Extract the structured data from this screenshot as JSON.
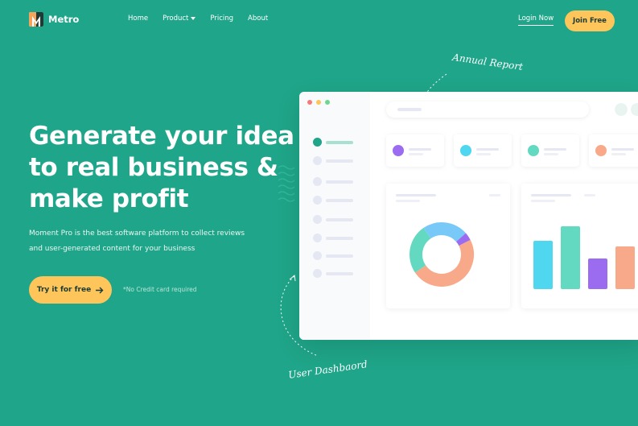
{
  "brand": {
    "name": "Metro"
  },
  "nav": {
    "items": [
      "Home",
      "Product",
      "Pricing",
      "About"
    ],
    "login_label": "Login Now",
    "join_label": "Join Free"
  },
  "hero": {
    "headline_lines": [
      "Generate your idea",
      "to real business &",
      "make profit"
    ],
    "subtitle_lines": [
      "Moment Pro is the best software platform to collect reviews",
      "and user-generated content for your business"
    ],
    "cta_label": "Try it for free",
    "cta_icon": "arrow-right-icon",
    "note": "*No Credit card required"
  },
  "annotations": {
    "annual_report": "Annual Report",
    "user_dashboard": "User Dashbaord"
  },
  "dashboard": {
    "window_dot_colors": [
      "#f47b7b",
      "#fdc55a",
      "#6fd68d"
    ],
    "stat_colors": [
      "#9b6cf0",
      "#4fd7ef",
      "#62d9c0",
      "#f8a98a"
    ],
    "donut": [
      {
        "value": 48,
        "color": "#f8a98a"
      },
      {
        "value": 25,
        "color": "#62d9c0"
      },
      {
        "value": 23,
        "color": "#78c9f8"
      },
      {
        "value": 4,
        "color": "#9b6cf0"
      }
    ],
    "bars": [
      {
        "value": 60,
        "color": "#4fd7ef"
      },
      {
        "value": 78,
        "color": "#62d9c0"
      },
      {
        "value": 38,
        "color": "#9b6cf0"
      },
      {
        "value": 53,
        "color": "#f8a98a"
      }
    ],
    "accent": "#1fa589"
  },
  "colors": {
    "background": "#1fa589",
    "button": "#fdc55a",
    "button_text": "#1d3b35"
  }
}
